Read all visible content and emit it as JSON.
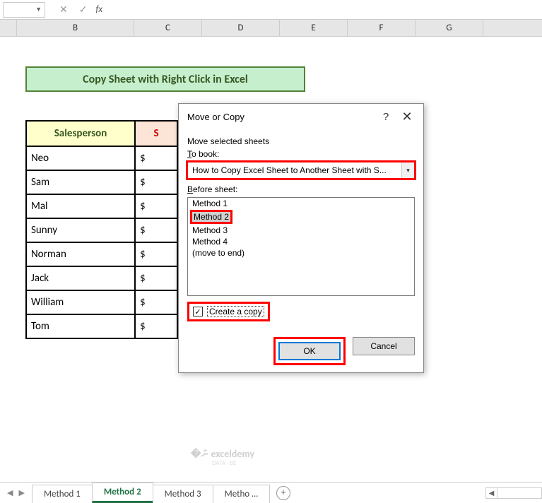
{
  "formula_bar": {
    "fx": "fx"
  },
  "columns": [
    "",
    "B",
    "C",
    "D",
    "E",
    "F",
    "G"
  ],
  "title": "Copy Sheet with Right Click in Excel",
  "table": {
    "headers": {
      "salesperson": "Salesperson",
      "col2": "S"
    },
    "rows": [
      {
        "name": "Neo",
        "val": "$"
      },
      {
        "name": "Sam",
        "val": "$"
      },
      {
        "name": "Mal",
        "val": "$"
      },
      {
        "name": "Sunny",
        "val": "$"
      },
      {
        "name": "Norman",
        "val": "$"
      },
      {
        "name": "Jack",
        "val": "$"
      },
      {
        "name": "William",
        "val": "$"
      },
      {
        "name": "Tom",
        "val": "$"
      }
    ]
  },
  "dialog": {
    "title": "Move or Copy",
    "subtitle": "Move selected sheets",
    "to_book_label": "To book:",
    "to_book_value": "How to Copy Excel Sheet to Another Sheet with S...",
    "before_sheet_label": "Before sheet:",
    "sheets": [
      "Method 1",
      "Method 2",
      "Method 3",
      "Method 4",
      "(move to end)"
    ],
    "selected_sheet": "Method 2",
    "create_copy_label": "Create a copy",
    "create_copy_checked": true,
    "ok": "OK",
    "cancel": "Cancel"
  },
  "tabs": {
    "items": [
      "Method 1",
      "Method 2",
      "Method 3",
      "Metho  …"
    ],
    "active": "Method 2"
  },
  "watermark": {
    "main": "exceldemy",
    "sub": "DATA · BE"
  }
}
